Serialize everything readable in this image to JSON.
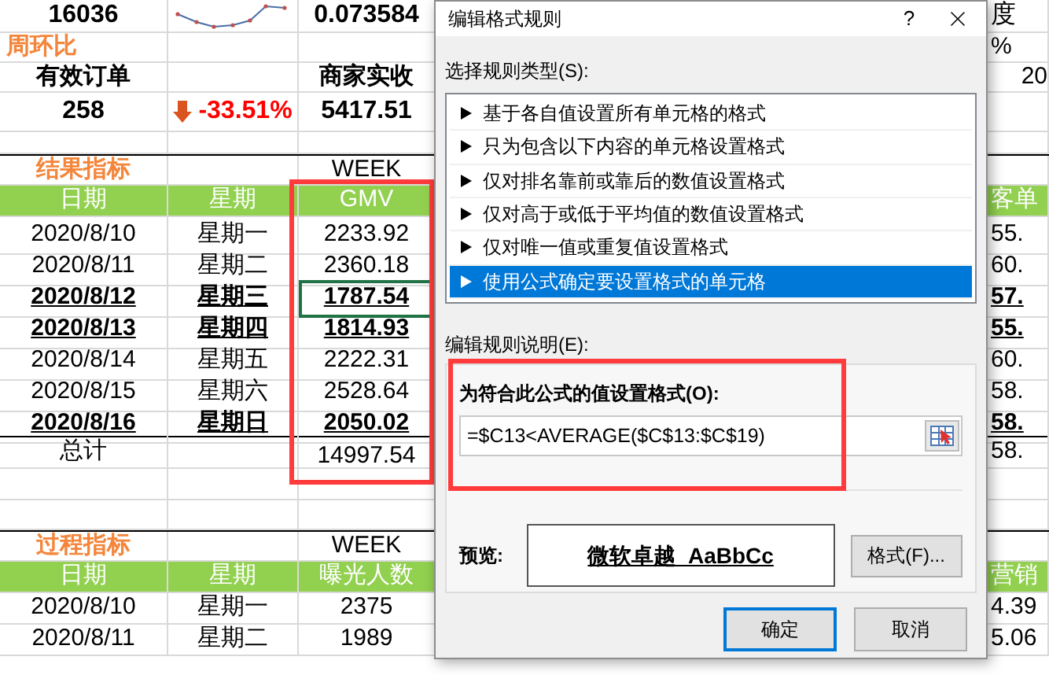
{
  "summary": {
    "value_1": "16036",
    "value_2": "0.073584",
    "column_5_top": "度",
    "wow_title": "周环比",
    "column_5_wow": "%",
    "label_1": "有效订单",
    "label_2": "商家实收",
    "column_5_label": "20",
    "orders": "258",
    "change": {
      "text": "-33.51%",
      "negative": true
    },
    "merchant_income": "5417.51"
  },
  "result_section": {
    "title": "结果指标",
    "week": "WEEK",
    "headers": [
      "日期",
      "星期",
      "GMV"
    ],
    "column_5_header": "客单",
    "rows": [
      {
        "date": "2020/8/10",
        "weekday": "星期一",
        "gmv": "2233.92",
        "column_5": "55.",
        "bold": false,
        "selected": false
      },
      {
        "date": "2020/8/11",
        "weekday": "星期二",
        "gmv": "2360.18",
        "column_5": "60.",
        "bold": false,
        "selected": false
      },
      {
        "date": "2020/8/12",
        "weekday": "星期三",
        "gmv": "1787.54",
        "column_5": "57.",
        "bold": true,
        "selected": true
      },
      {
        "date": "2020/8/13",
        "weekday": "星期四",
        "gmv": "1814.93",
        "column_5": "55.",
        "bold": true,
        "selected": false
      },
      {
        "date": "2020/8/14",
        "weekday": "星期五",
        "gmv": "2222.31",
        "column_5": "60.",
        "bold": false,
        "selected": false
      },
      {
        "date": "2020/8/15",
        "weekday": "星期六",
        "gmv": "2528.64",
        "column_5": "58.",
        "bold": false,
        "selected": false
      },
      {
        "date": "2020/8/16",
        "weekday": "星期日",
        "gmv": "2050.02",
        "column_5": "58.",
        "bold": true,
        "selected": false
      }
    ],
    "total": {
      "label": "总计",
      "gmv": "14997.54",
      "column_5": "58."
    }
  },
  "process_section": {
    "title": "过程指标",
    "week": "WEEK",
    "headers": [
      "日期",
      "星期",
      "曝光人数"
    ],
    "column_5_header": "营销",
    "rows": [
      {
        "date": "2020/8/10",
        "weekday": "星期一",
        "value": "2375",
        "column_5": "4.39"
      },
      {
        "date": "2020/8/11",
        "weekday": "星期二",
        "value": "1989",
        "column_5": "5.06"
      }
    ]
  },
  "dialog": {
    "title": "编辑格式规则",
    "help": "?",
    "rule_type_label": "选择规则类型(S):",
    "rule_types": [
      {
        "label": "基于各自值设置所有单元格的格式",
        "selected": false
      },
      {
        "label": "只为包含以下内容的单元格设置格式",
        "selected": false
      },
      {
        "label": "仅对排名靠前或靠后的数值设置格式",
        "selected": false
      },
      {
        "label": "仅对高于或低于平均值的数值设置格式",
        "selected": false
      },
      {
        "label": "仅对唯一值或重复值设置格式",
        "selected": false
      },
      {
        "label": "使用公式确定要设置格式的单元格",
        "selected": true
      }
    ],
    "description_label": "编辑规则说明(E):",
    "formula_label": "为符合此公式的值设置格式(O):",
    "formula": "=$C13<AVERAGE($C$13:$C$19)",
    "preview_label": "预览:",
    "preview_text": "微软卓越  AaBbCc",
    "format_button": "格式(F)...",
    "ok": "确定",
    "cancel": "取消"
  }
}
